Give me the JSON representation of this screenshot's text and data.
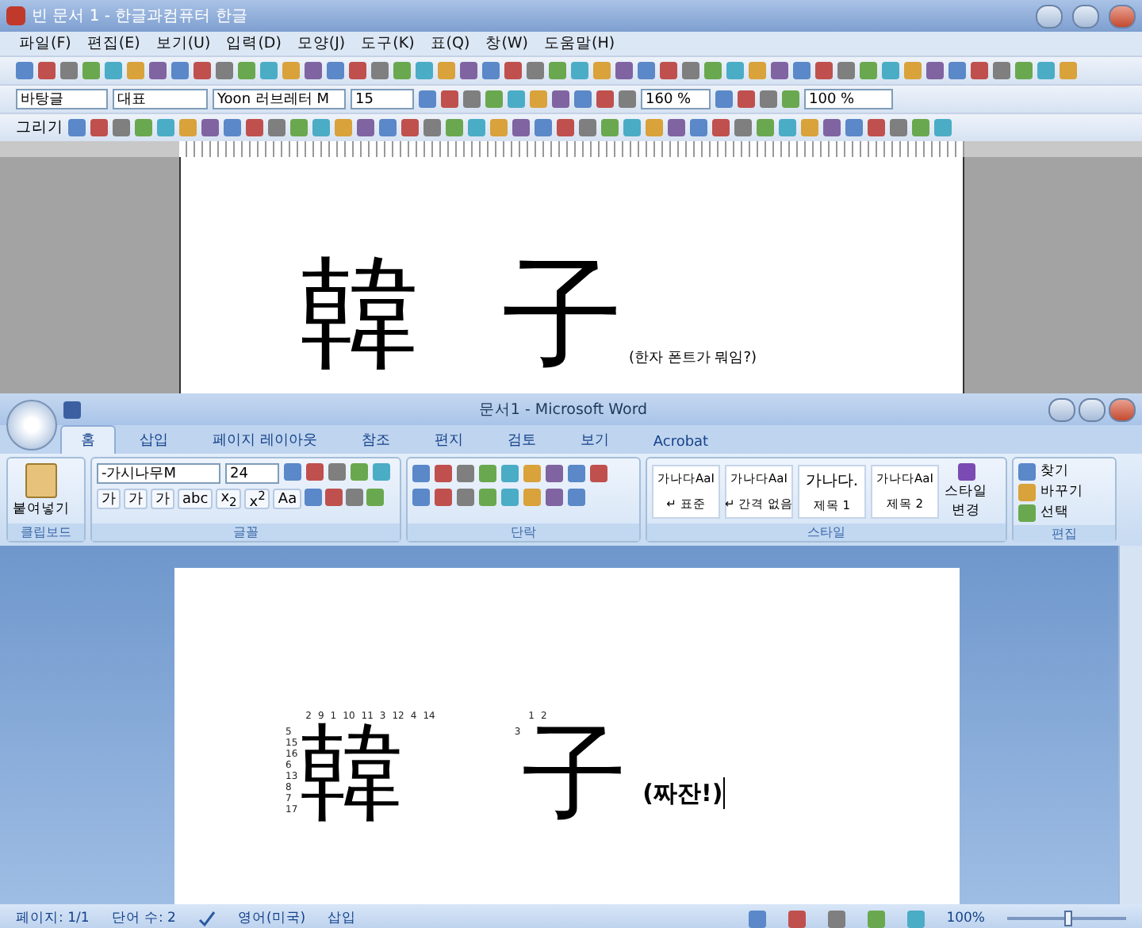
{
  "hwp": {
    "title": "빈 문서 1 - 한글과컴퓨터 한글",
    "menu": [
      "파일(F)",
      "편집(E)",
      "보기(U)",
      "입력(D)",
      "모양(J)",
      "도구(K)",
      "표(Q)",
      "창(W)",
      "도움말(H)"
    ],
    "style_box": "바탕글",
    "style_kind": "대표",
    "font": "Yoon 러브레터 M",
    "size": "15",
    "line_zoom": "160 %",
    "zoom": "100 %",
    "draw_menu": "그리기",
    "page": {
      "chars": [
        "韓",
        "子"
      ],
      "note": "(한자 폰트가 뭐임?)"
    }
  },
  "word": {
    "title": "문서1 - Microsoft Word",
    "tabs": [
      {
        "label": "홈",
        "selected": true
      },
      {
        "label": "삽입",
        "selected": false
      },
      {
        "label": "페이지 레이아웃",
        "selected": false
      },
      {
        "label": "참조",
        "selected": false
      },
      {
        "label": "편지",
        "selected": false
      },
      {
        "label": "검토",
        "selected": false
      },
      {
        "label": "보기",
        "selected": false
      },
      {
        "label": "Acrobat",
        "selected": false
      }
    ],
    "clipboard": {
      "paste": "붙여넣기",
      "label": "클립보드"
    },
    "font": {
      "name": "-가시나무M",
      "size": "24",
      "buttons": [
        "가",
        "가",
        "가",
        "abc",
        "x$_{2}$",
        "x$^{2}$",
        "Aa"
      ],
      "label": "글꼴"
    },
    "paragraph": {
      "label": "단락"
    },
    "styles": {
      "items": [
        {
          "preview": "가나다AaI",
          "name": "↵ 표준"
        },
        {
          "preview": "가나다AaI",
          "name": "↵ 간격 없음"
        },
        {
          "preview": "가나다.",
          "name": "제목 1"
        },
        {
          "preview": "가나다AaI",
          "name": "제목 2"
        }
      ],
      "change": "스타일 변경",
      "label": "스타일"
    },
    "editing": {
      "items": [
        "찾기",
        "바꾸기",
        "선택"
      ],
      "label": "편집"
    },
    "page": {
      "chars": [
        {
          "char": "韓",
          "strokes": [
            "2",
            "9",
            "1",
            "10",
            "11",
            "3",
            "12",
            "4",
            "14",
            "5",
            "15",
            "16",
            "6",
            "13",
            "8",
            "7",
            "17"
          ]
        },
        {
          "char": "子",
          "strokes": [
            "1",
            "2",
            "3"
          ]
        }
      ],
      "note": "(짜잔!)"
    },
    "status": [
      "페이지: 1/1",
      "단어 수: 2",
      "영어(미국)",
      "삽입"
    ],
    "zoom": "100%",
    "zoom_slider": {
      "level": 0.5
    }
  }
}
